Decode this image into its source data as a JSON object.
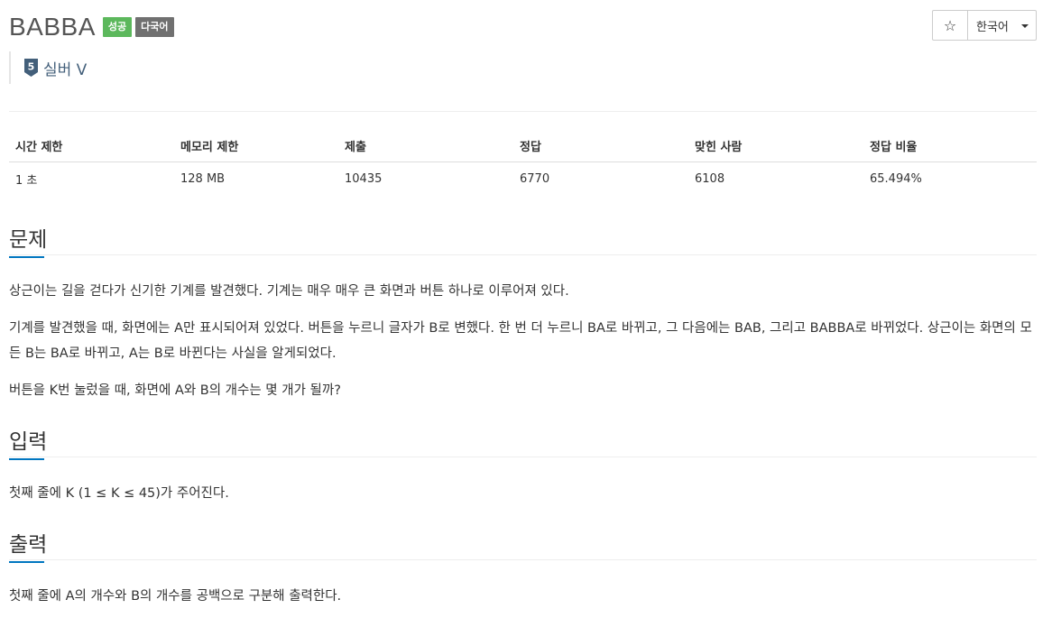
{
  "problem": {
    "title": "BABBA",
    "badges": {
      "status": "성공",
      "language": "다국어"
    },
    "tier": {
      "number": "5",
      "label": "실버 V"
    }
  },
  "toolbar": {
    "star_label": "☆",
    "language_label": "한국어"
  },
  "stats": {
    "headers": [
      "시간 제한",
      "메모리 제한",
      "제출",
      "정답",
      "맞힌 사람",
      "정답 비율"
    ],
    "values": [
      "1 초",
      "128 MB",
      "10435",
      "6770",
      "6108",
      "65.494%"
    ]
  },
  "sections": {
    "problem": {
      "heading": "문제",
      "paragraphs": [
        "상근이는 길을 걷다가 신기한 기계를 발견했다. 기계는 매우 매우 큰 화면과 버튼 하나로 이루어져 있다.",
        "기계를 발견했을 때, 화면에는 A만 표시되어져 있었다. 버튼을 누르니 글자가 B로 변했다. 한 번 더 누르니 BA로 바뀌고, 그 다음에는 BAB, 그리고 BABBA로 바뀌었다. 상근이는 화면의 모든 B는 BA로 바뀌고, A는 B로 바뀐다는 사실을 알게되었다.",
        "버튼을 K번 눌렀을 때, 화면에 A와 B의 개수는 몇 개가 될까?"
      ]
    },
    "input": {
      "heading": "입력",
      "text": "첫째 줄에 K (1 ≤ K ≤ 45)가 주어진다."
    },
    "output": {
      "heading": "출력",
      "text": "첫째 줄에 A의 개수와 B의 개수를 공백으로 구분해 출력한다."
    }
  },
  "colors": {
    "accent": "#0076c0",
    "success": "#5cb85c",
    "tier_silver": "#435f7a"
  }
}
